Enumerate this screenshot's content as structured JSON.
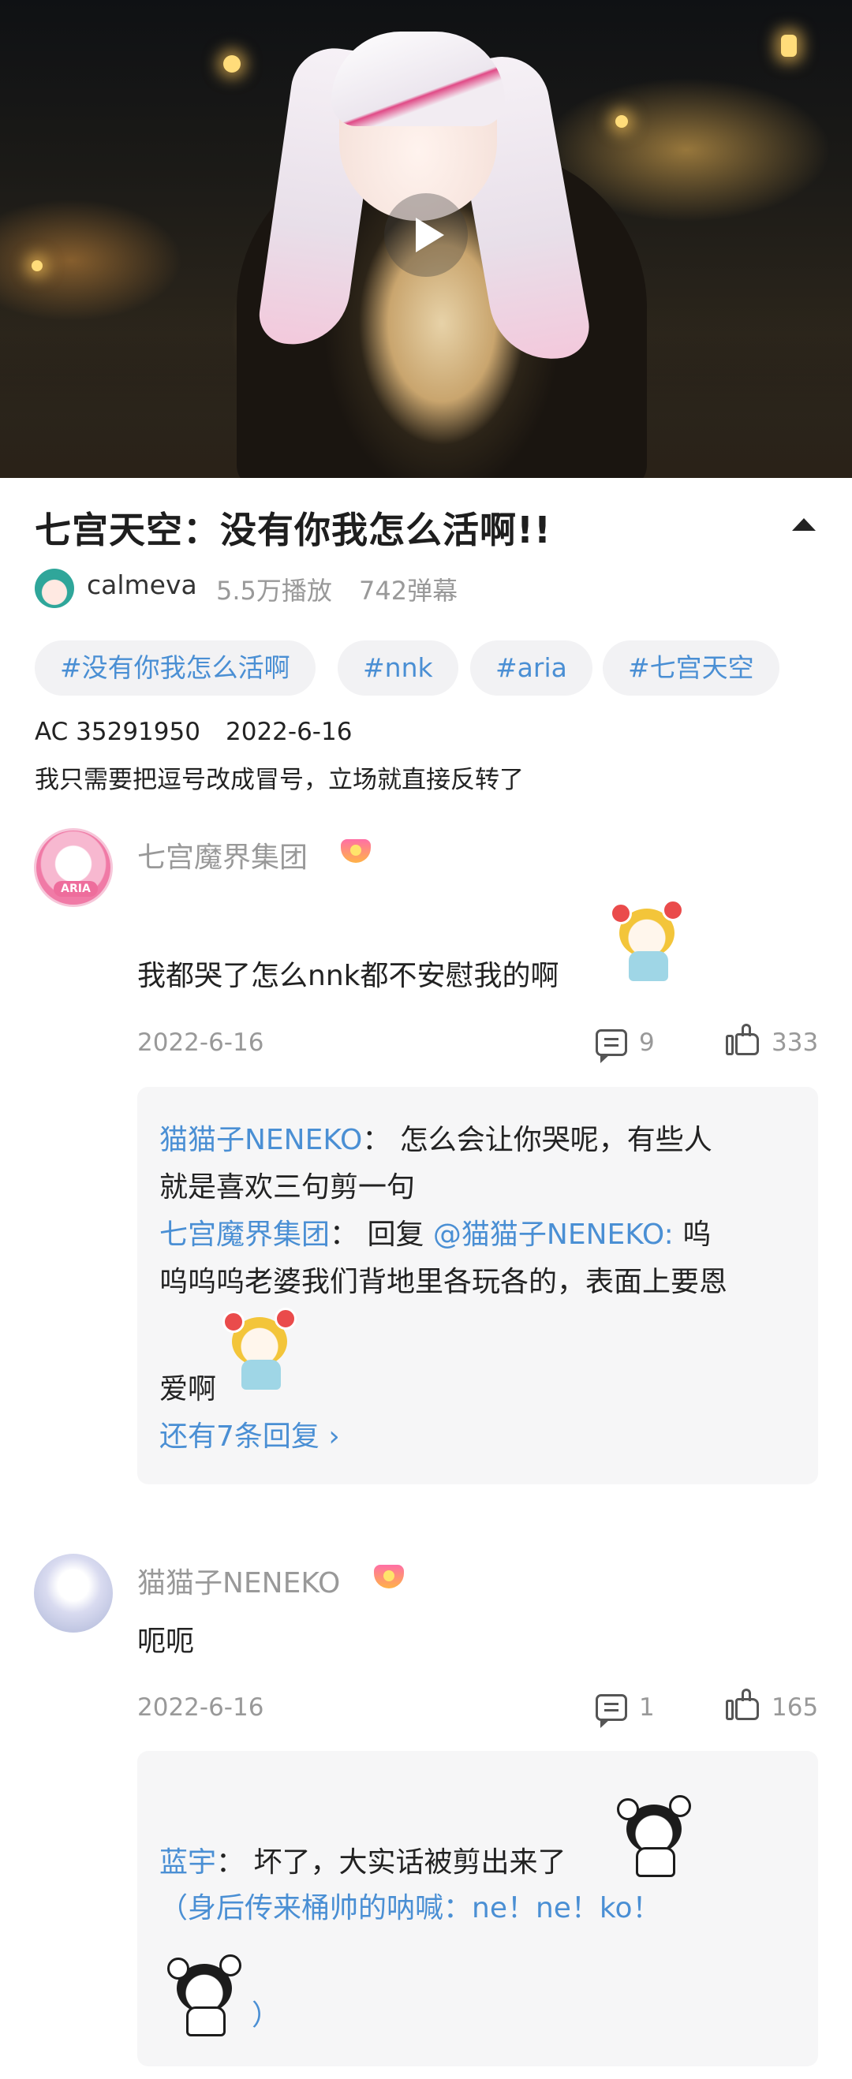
{
  "video": {
    "play_icon": "play-icon"
  },
  "info": {
    "title": "七宫天空：没有你我怎么活啊!!",
    "uploader": "calmeva",
    "plays": "5.5万播放",
    "danmaku": "742弹幕",
    "tags": [
      "#没有你我怎么活啊",
      "#nnk",
      "#aria",
      "#七宫天空"
    ],
    "ac_id": "AC 35291950",
    "date": "2022-6-16",
    "description": "我只需要把逗号改成冒号，立场就直接反转了"
  },
  "comments": [
    {
      "user": "七宫魔界集团",
      "avatar_text": "ARIA",
      "text": "我都哭了怎么nnk都不安慰我的啊",
      "date": "2022-6-16",
      "reply_count": "9",
      "like_count": "333",
      "replies": [
        {
          "user": "猫猫子NENEKO",
          "sep": "：",
          "line1": " 怎么会让你哭呢，有些人",
          "line2": "就是喜欢三句剪一句"
        },
        {
          "user": "七宫魔界集团",
          "sep": "：",
          "reply_word": " 回复 ",
          "mention": "@猫猫子NENEKO:",
          "line1_tail": " 呜",
          "line2": "呜呜呜老婆我们背地里各玩各的，表面上要恩",
          "line3": "爱啊"
        }
      ],
      "more_replies": "还有7条回复 ›"
    },
    {
      "user": "猫猫子NENEKO",
      "text": "呃呃",
      "date": "2022-6-16",
      "reply_count": "1",
      "like_count": "165",
      "replies": [
        {
          "user": "蓝宇",
          "sep": "：",
          "line1": " 坏了，大实话被剪出来了",
          "line2": "（身后传来桶帅的呐喊：ne！ne！ko！",
          "line3": "）"
        }
      ]
    }
  ]
}
